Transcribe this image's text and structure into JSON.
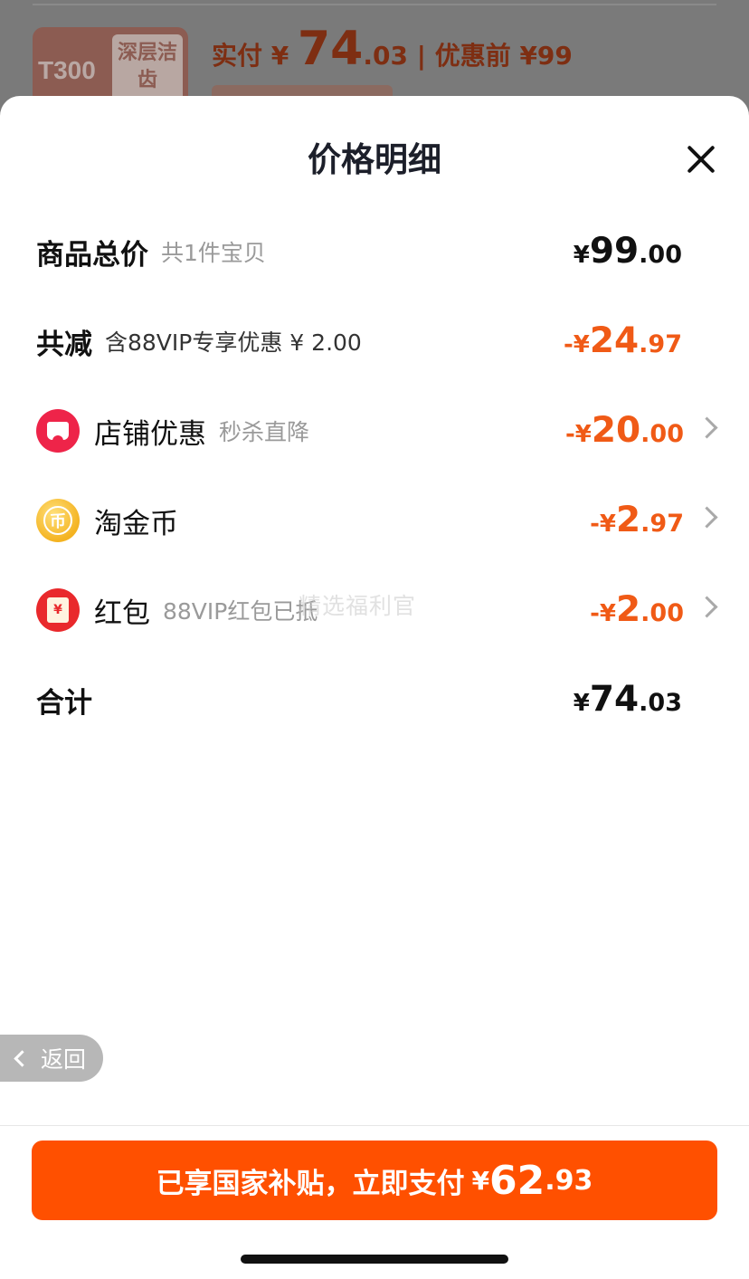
{
  "background_page": {
    "thumb_model": "T300",
    "thumb_badge": "深层洁齿",
    "paid_prefix": "实付 ¥ ",
    "paid_int": "74",
    "paid_dec": ".03",
    "paid_suffix": " | 优惠前 ¥99"
  },
  "sheet": {
    "title": "价格明细",
    "rows": {
      "total": {
        "label": "商品总价",
        "sub": "共1件宝贝",
        "sym": "¥",
        "int": "99",
        "dec": ".00"
      },
      "reduce": {
        "label": "共减",
        "sub": "含88VIP专享优惠 ¥ 2.00",
        "sym": "-¥",
        "int": "24",
        "dec": ".97"
      },
      "store": {
        "label": "店铺优惠",
        "sub": "秒杀直降",
        "sym": "-¥",
        "int": "20",
        "dec": ".00"
      },
      "coin": {
        "label": "淘金币",
        "glyph": "币",
        "sym": "-¥",
        "int": "2",
        "dec": ".97"
      },
      "redpacket": {
        "label": "红包",
        "sub": "88VIP红包已抵",
        "glyph": "¥",
        "sym": "-¥",
        "int": "2",
        "dec": ".00"
      },
      "sum": {
        "label": "合计",
        "sym": "¥",
        "int": "74",
        "dec": ".03"
      }
    },
    "watermark": "精选福利官"
  },
  "back_button": {
    "label": "返回"
  },
  "pay_button": {
    "label": "已享国家补贴，立即支付",
    "sym": "¥",
    "int": "62",
    "dec": ".93"
  },
  "colors": {
    "accent": "#ff5000",
    "discount": "#f05a16"
  }
}
